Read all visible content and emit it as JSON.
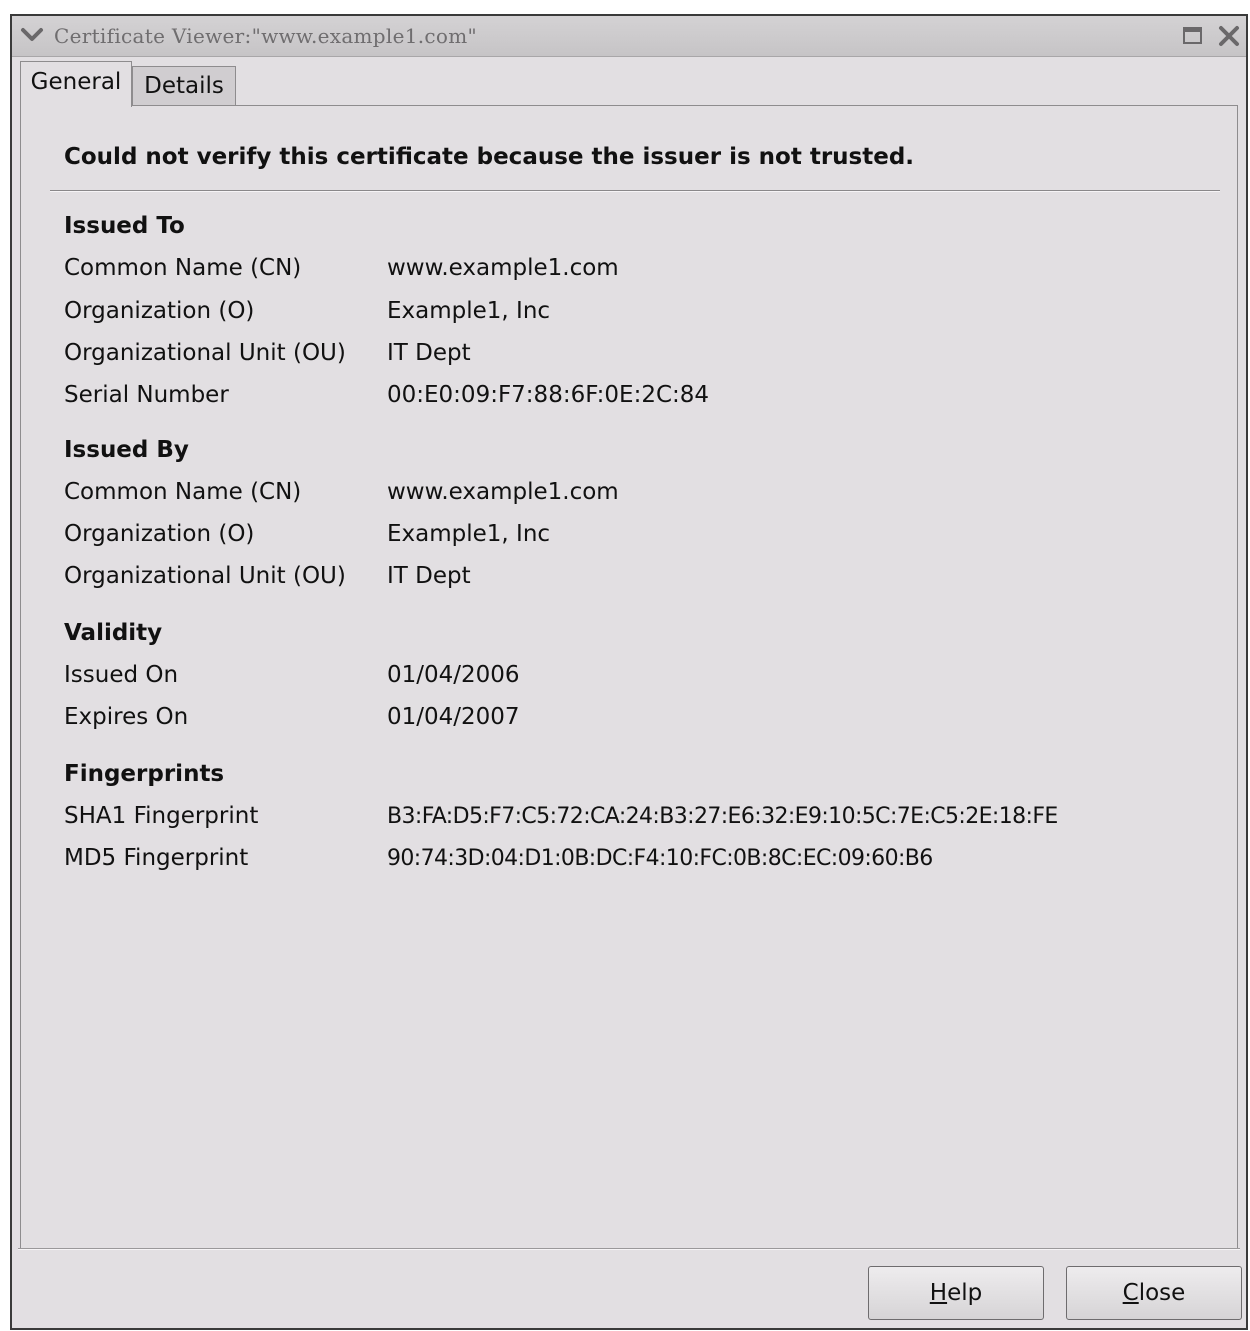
{
  "window": {
    "title": "Certificate Viewer:\"www.example1.com\""
  },
  "tabs": [
    {
      "label": "General",
      "active": true
    },
    {
      "label": "Details",
      "active": false
    }
  ],
  "general": {
    "warning": "Could not verify this certificate because the issuer is not trusted.",
    "issued_to": {
      "heading": "Issued To",
      "rows": [
        {
          "label": "Common Name (CN)",
          "value": "www.example1.com"
        },
        {
          "label": "Organization (O)",
          "value": "Example1, Inc"
        },
        {
          "label": "Organizational Unit (OU)",
          "value": "IT Dept"
        },
        {
          "label": "Serial Number",
          "value": "00:E0:09:F7:88:6F:0E:2C:84"
        }
      ]
    },
    "issued_by": {
      "heading": "Issued By",
      "rows": [
        {
          "label": "Common Name (CN)",
          "value": "www.example1.com"
        },
        {
          "label": "Organization (O)",
          "value": "Example1, Inc"
        },
        {
          "label": "Organizational Unit (OU)",
          "value": "IT Dept"
        }
      ]
    },
    "validity": {
      "heading": "Validity",
      "rows": [
        {
          "label": "Issued On",
          "value": "01/04/2006"
        },
        {
          "label": "Expires On",
          "value": "01/04/2007"
        }
      ]
    },
    "fingerprints": {
      "heading": "Fingerprints",
      "rows": [
        {
          "label": "SHA1 Fingerprint",
          "value": "B3:FA:D5:F7:C5:72:CA:24:B3:27:E6:32:E9:10:5C:7E:C5:2E:18:FE"
        },
        {
          "label": "MD5 Fingerprint",
          "value": "90:74:3D:04:D1:0B:DC:F4:10:FC:0B:8C:EC:09:60:B6"
        }
      ]
    }
  },
  "buttons": {
    "help": {
      "mnemonic": "H",
      "rest": "elp"
    },
    "close": {
      "mnemonic": "C",
      "rest": "lose"
    }
  },
  "icons": {
    "window_menu": "chevron-down-icon",
    "maximize": "maximize-icon",
    "close": "close-icon"
  }
}
